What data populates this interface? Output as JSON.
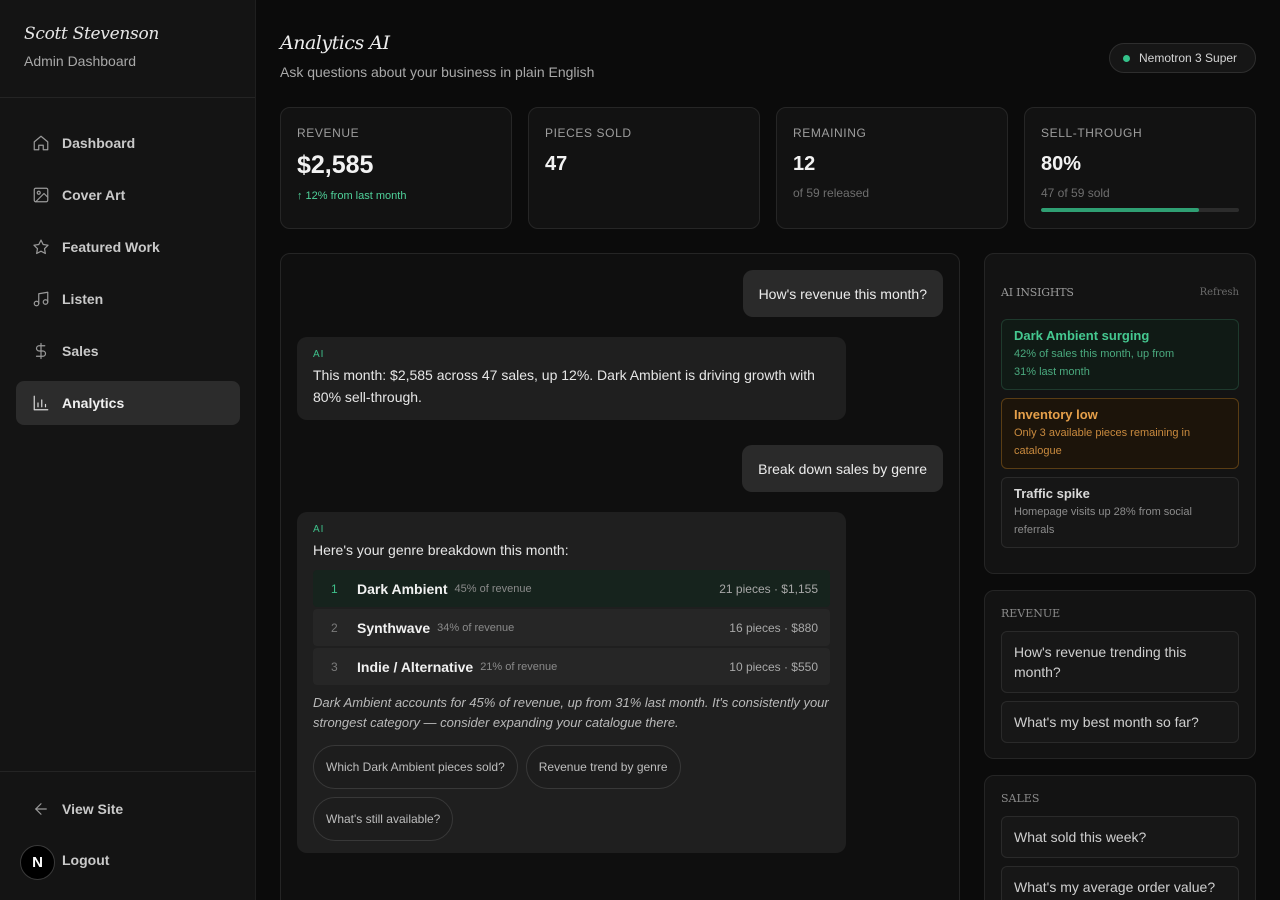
{
  "brand": {
    "name": "Scott Stevenson",
    "subtitle": "Admin Dashboard"
  },
  "nav": [
    {
      "label": "Dashboard",
      "icon": "home-icon"
    },
    {
      "label": "Cover Art",
      "icon": "image-icon"
    },
    {
      "label": "Featured Work",
      "icon": "star-icon"
    },
    {
      "label": "Listen",
      "icon": "music-icon"
    },
    {
      "label": "Sales",
      "icon": "dollar-icon"
    },
    {
      "label": "Analytics",
      "icon": "bar-chart-icon",
      "active": true
    }
  ],
  "footer": {
    "view_site": "View Site",
    "logout": "Logout",
    "avatar_letter": "N"
  },
  "header": {
    "title": "Analytics AI",
    "subtitle": "Ask questions about your business in plain English",
    "model": "Nemotron 3 Super"
  },
  "stats": {
    "revenue": {
      "label": "REVENUE",
      "value": "$2,585",
      "trend": "↑ 12% from last month"
    },
    "pieces_sold": {
      "label": "PIECES SOLD",
      "value": "47"
    },
    "remaining": {
      "label": "REMAINING",
      "value": "12",
      "note": "of 59 released"
    },
    "sell_through": {
      "label": "SELL-THROUGH",
      "value": "80%",
      "note": "47 of 59 sold",
      "progress": 0.8
    }
  },
  "chat": {
    "q1": "How's revenue this month?",
    "a1_tag": "AI",
    "a1": "This month: $2,585 across 47 sales, up 12%. Dark Ambient is driving growth with 80% sell-through.",
    "q2": "Break down sales by genre",
    "a2_tag": "AI",
    "a2_intro": "Here's your genre breakdown this month:",
    "genres": [
      {
        "rank": "1",
        "name": "Dark Ambient",
        "pct": "45% of revenue",
        "stats": "21 pieces · $1,155"
      },
      {
        "rank": "2",
        "name": "Synthwave",
        "pct": "34% of revenue",
        "stats": "16 pieces · $880"
      },
      {
        "rank": "3",
        "name": "Indie / Alternative",
        "pct": "21% of revenue",
        "stats": "10 pieces · $550"
      }
    ],
    "a2_summary": "Dark Ambient accounts for 45% of revenue, up from 31% last month. It's consistently your strongest category — consider expanding your catalogue there.",
    "suggestions": [
      "Which Dark Ambient pieces sold?",
      "Revenue trend by genre",
      "What's still available?"
    ]
  },
  "insights": {
    "title": "AI INSIGHTS",
    "refresh": "Refresh",
    "items": [
      {
        "title": "Dark Ambient surging",
        "text": "42% of sales this month, up from 31% last month"
      },
      {
        "title": "Inventory low",
        "text": "Only 3 available pieces remaining in catalogue"
      },
      {
        "title": "Traffic spike",
        "text": "Homepage visits up 28% from social referrals"
      }
    ]
  },
  "revenue_questions": {
    "title": "REVENUE",
    "items": [
      "How's revenue trending this month?",
      "What's my best month so far?"
    ]
  },
  "sales_questions": {
    "title": "SALES",
    "items": [
      "What sold this week?",
      "What's my average order value?"
    ]
  },
  "colors": {
    "accent_green": "#3ec08a",
    "amber": "#e6a04a"
  }
}
